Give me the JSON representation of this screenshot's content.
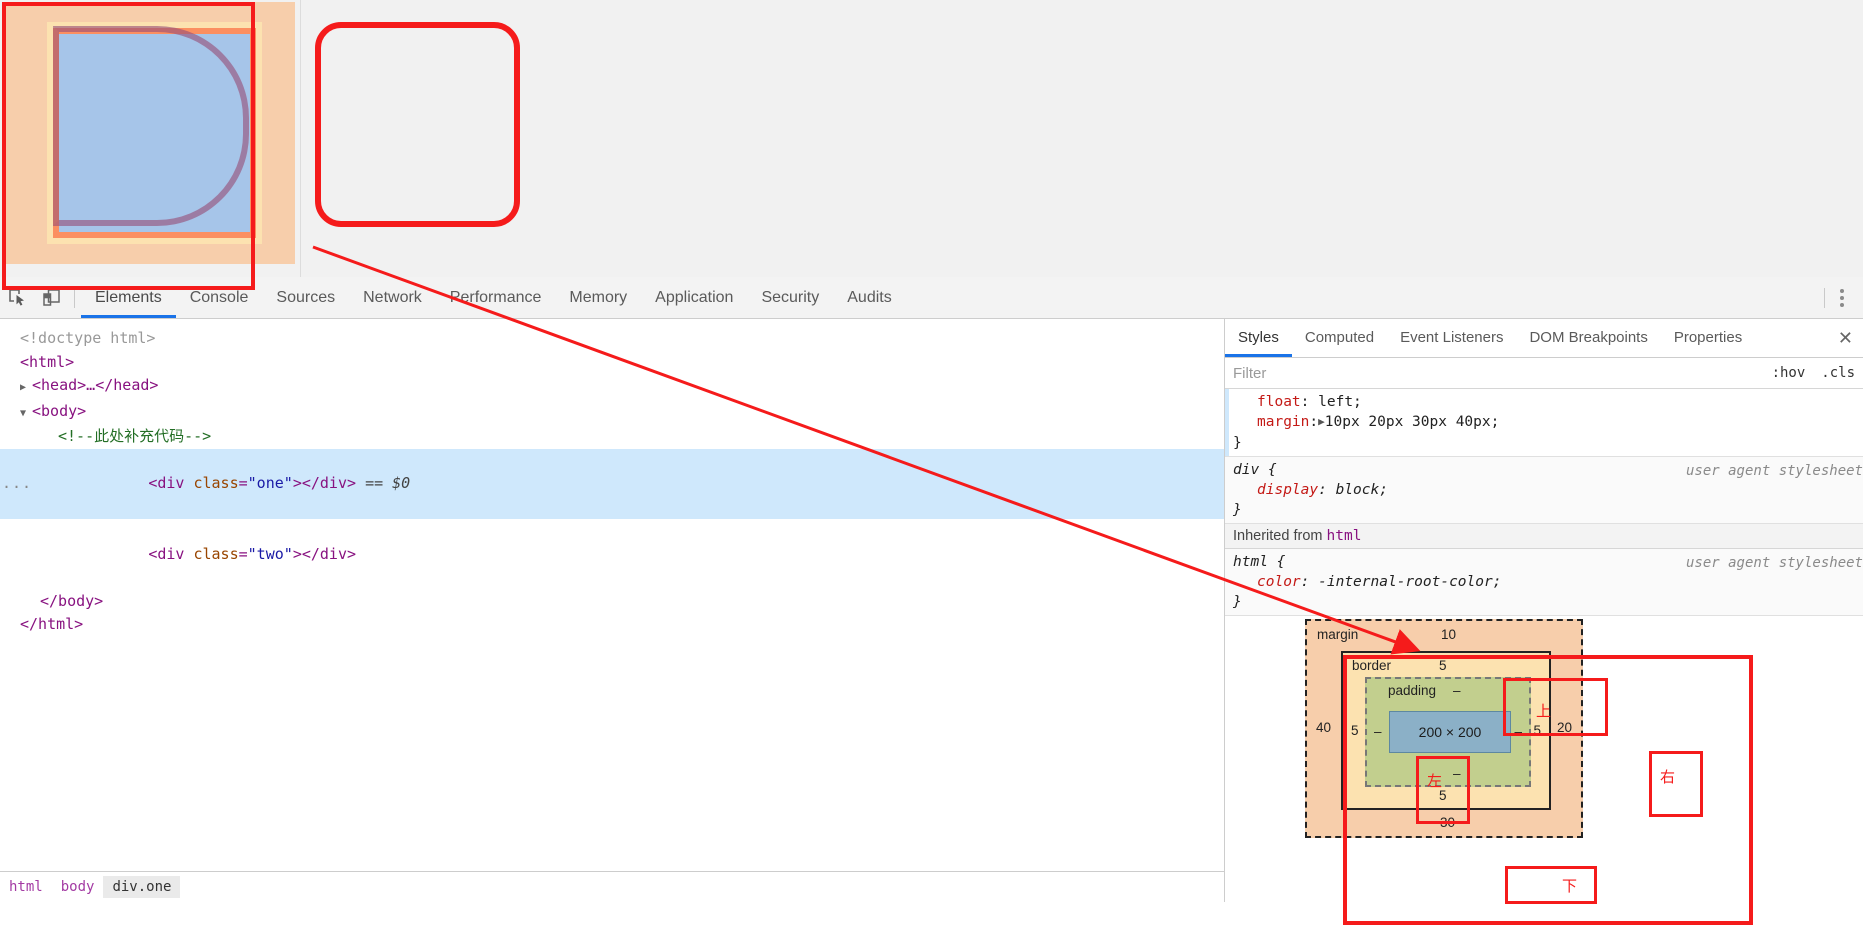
{
  "viewport": {
    "highlight": {
      "margin_color": "#f7ceab",
      "padding_color": "#fce2b0",
      "border_color": "#fb8f61",
      "content_color": "#a6c5e9",
      "radius_overlay_color": "#965078"
    }
  },
  "devtools": {
    "toolbar": {
      "icons": [
        {
          "name": "inspect-element-icon",
          "label": "Inspect element"
        },
        {
          "name": "device-toolbar-icon",
          "label": "Toggle device toolbar"
        }
      ],
      "tabs": [
        {
          "label": "Elements",
          "active": true
        },
        {
          "label": "Console",
          "active": false
        },
        {
          "label": "Sources",
          "active": false
        },
        {
          "label": "Network",
          "active": false
        },
        {
          "label": "Performance",
          "active": false
        },
        {
          "label": "Memory",
          "active": false
        },
        {
          "label": "Application",
          "active": false
        },
        {
          "label": "Security",
          "active": false
        },
        {
          "label": "Audits",
          "active": false
        }
      ],
      "menu_label": "More options"
    },
    "dom": {
      "doctype": "<!doctype html>",
      "html_open": "<html>",
      "head_line": "<head>…</head>",
      "body_open": "<body>",
      "comment": "<!--此处补充代码-->",
      "div_one": "<div class=\"one\"></div>",
      "div_one_marker": "== $0",
      "div_two": "<div class=\"two\"></div>",
      "body_close": "</body>",
      "html_close": "</html>",
      "ellipsis": "..."
    },
    "breadcrumb": [
      {
        "label": "html",
        "active": false
      },
      {
        "label": "body",
        "active": false
      },
      {
        "label": "div.one",
        "active": true
      }
    ],
    "styles": {
      "tabs": [
        {
          "label": "Styles",
          "active": true
        },
        {
          "label": "Computed",
          "active": false
        },
        {
          "label": "Event Listeners",
          "active": false
        },
        {
          "label": "DOM Breakpoints",
          "active": false
        },
        {
          "label": "Properties",
          "active": false
        }
      ],
      "close_label": "✕",
      "filter_placeholder": "Filter",
      "hov_label": ":hov",
      "cls_label": ".cls",
      "rules": [
        {
          "selector": "",
          "origin": "",
          "declarations": [
            {
              "prop": "float",
              "value": "left;"
            },
            {
              "prop": "margin",
              "value": "10px 20px 30px 40px;",
              "expandable": true
            }
          ],
          "close": "}"
        },
        {
          "selector": "div {",
          "origin": "user agent stylesheet",
          "declarations": [
            {
              "prop": "display",
              "value": "block;"
            }
          ],
          "close": "}"
        }
      ],
      "inherited_label": "Inherited from",
      "inherited_from": "html",
      "inherited_rule": {
        "selector": "html {",
        "origin": "user agent stylesheet",
        "declarations": [
          {
            "prop": "color",
            "value": "-internal-root-color;"
          }
        ],
        "close": "}"
      }
    },
    "box_model": {
      "margin_label": "margin",
      "border_label": "border",
      "padding_label": "padding",
      "content_size": "200 × 200",
      "margin": {
        "top": "10",
        "right": "20",
        "bottom": "30",
        "left": "40"
      },
      "border": {
        "top": "5",
        "right": "5",
        "bottom": "5",
        "left": "5"
      },
      "padding": {
        "top": "–",
        "right": "–",
        "bottom": "–",
        "left": "–"
      }
    }
  },
  "annotations": {
    "color": "#f51b1b",
    "cn_top": "上",
    "cn_right": "右",
    "cn_bottom": "下",
    "cn_left": "左"
  }
}
